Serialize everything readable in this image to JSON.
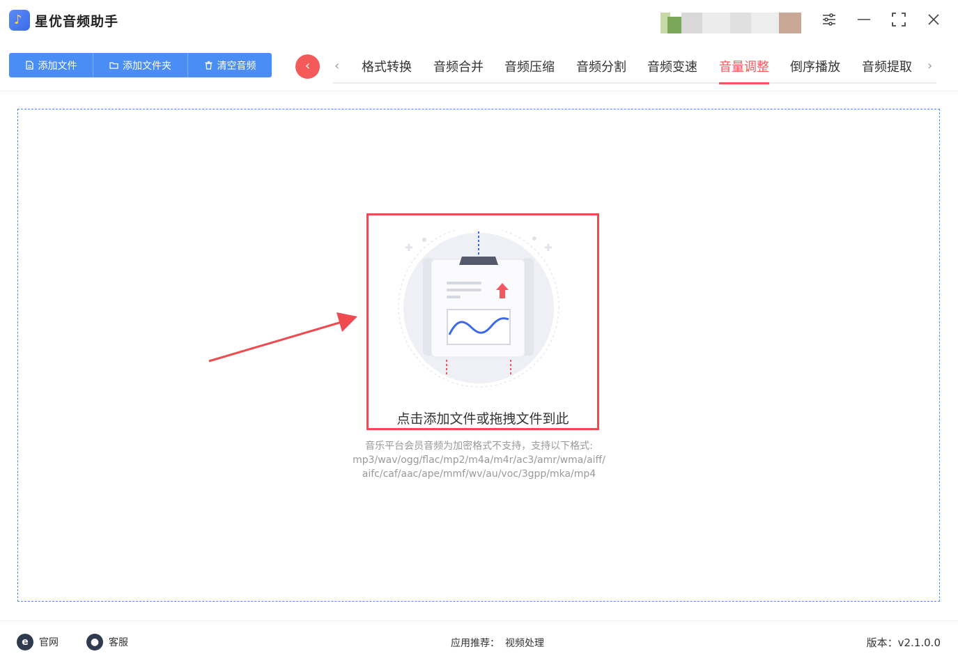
{
  "app": {
    "title": "星优音频助手"
  },
  "toolbar": {
    "add_file": "添加文件",
    "add_folder": "添加文件夹",
    "clear_audio": "清空音频"
  },
  "tabs": [
    {
      "label": "格式转换"
    },
    {
      "label": "音频合并"
    },
    {
      "label": "音频压缩"
    },
    {
      "label": "音频分割"
    },
    {
      "label": "音频变速"
    },
    {
      "label": "音量调整"
    },
    {
      "label": "倒序播放"
    },
    {
      "label": "音频提取"
    }
  ],
  "active_tab": "音量调整",
  "dropzone": {
    "label": "点击添加文件或拖拽文件到此",
    "note_line1": "音乐平台会员音频为加密格式不支持，支持以下格式:",
    "note_line2": "mp3/wav/ogg/flac/mp2/m4a/m4r/ac3/amr/wma/aiff/",
    "note_line3": "aifc/caf/aac/ape/mmf/wv/au/voc/3gpp/mka/mp4"
  },
  "footer": {
    "website": "官网",
    "support": "客服",
    "recommend_label": "应用推荐：",
    "recommend_link": "视频处理",
    "version": "版本：v2.1.0.0"
  },
  "colors": {
    "accent": "#4a8df4",
    "active_tab": "#f2585d",
    "highlight": "#ef4a4f"
  }
}
